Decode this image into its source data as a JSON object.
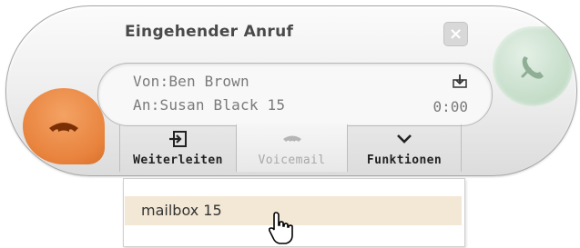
{
  "window": {
    "title": "Eingehender Anruf"
  },
  "call": {
    "from": "Von:Ben Brown",
    "to": "An:Susan Black 15",
    "duration": "0:00"
  },
  "toolbar": {
    "forward_label": "Weiterleiten",
    "voicemail_label": "Voicemail",
    "functions_label": "Funktionen"
  },
  "dropdown": {
    "items": [
      "mailbox 15"
    ]
  },
  "icons": {
    "close": "close-icon",
    "accept": "phone-accept-icon",
    "reject": "phone-hangup-icon",
    "download": "download-icon",
    "forward": "forward-icon",
    "voicemail": "voicemail-icon",
    "functions": "chevron-down-icon",
    "cursor": "hand-pointer-icon"
  },
  "colors": {
    "accept": "#c3dcc7",
    "reject": "#e8833d",
    "highlight": "#f3e7d5"
  }
}
